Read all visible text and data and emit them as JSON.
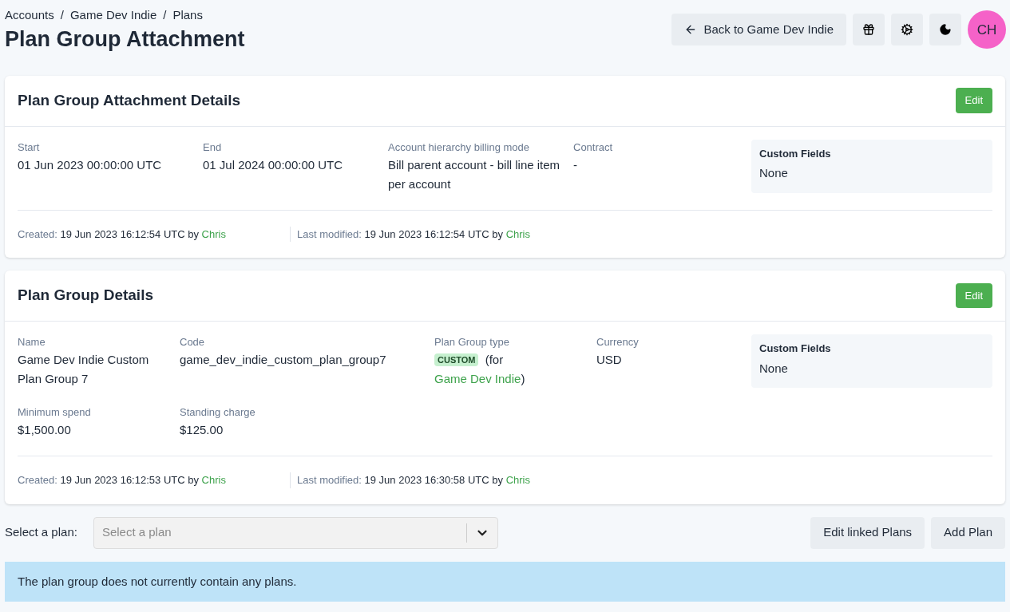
{
  "breadcrumbs": [
    "Accounts",
    "/",
    "Game Dev Indie",
    "/",
    "Plans"
  ],
  "title": "Plan Group Attachment",
  "header_actions": {
    "back_button": "Back to Game Dev Indie",
    "avatar": "CH"
  },
  "cards": [
    {
      "title": "Plan Group Attachment Details",
      "edit_button": "Edit",
      "fields": [
        {
          "label": "Start",
          "value": [
            {
              "kind": "text",
              "text": "01 Jun 2023 00:00:00 UTC"
            }
          ]
        },
        {
          "label": "End",
          "value": [
            {
              "kind": "text",
              "text": "01 Jul 2024 00:00:00 UTC"
            }
          ]
        },
        {
          "label": "Account hierarchy billing mode",
          "value": [
            {
              "kind": "text",
              "text": "Bill parent account - bill line item per account"
            }
          ]
        },
        {
          "label": "Contract",
          "value": [
            {
              "kind": "text",
              "text": "-"
            }
          ]
        }
      ],
      "custom_fields": {
        "label": "Custom Fields",
        "value": "None"
      },
      "footer": [
        [
          {
            "kind": "label",
            "text": "Created:"
          },
          {
            "kind": "text",
            "text": " 19 Jun 2023 16:12:54 UTC by "
          },
          {
            "kind": "link",
            "text": "Chris"
          }
        ],
        [
          {
            "kind": "label",
            "text": "Last modified:"
          },
          {
            "kind": "text",
            "text": " 19 Jun 2023 16:12:54 UTC by "
          },
          {
            "kind": "link",
            "text": "Chris"
          }
        ]
      ]
    },
    {
      "title": "Plan Group Details",
      "edit_button": "Edit",
      "fields": [
        {
          "label": "Name",
          "value": [
            {
              "kind": "text",
              "text": "Game Dev Indie Custom Plan Group 7"
            }
          ]
        },
        {
          "label": "Code",
          "value": [
            {
              "kind": "text",
              "text": "game_dev_indie_custom_plan_group7"
            }
          ]
        },
        {
          "label": "Plan Group type",
          "value": [
            {
              "kind": "badge",
              "text": "CUSTOM"
            },
            {
              "kind": "text",
              "text": " (for "
            },
            {
              "kind": "link",
              "text": "Game Dev Indie"
            },
            {
              "kind": "text",
              "text": ")"
            }
          ]
        },
        {
          "label": "Currency",
          "value": [
            {
              "kind": "text",
              "text": "USD"
            }
          ]
        },
        {
          "label": "Minimum spend",
          "value": [
            {
              "kind": "text",
              "text": "$1,500.00"
            }
          ]
        },
        {
          "label": "Standing charge",
          "value": [
            {
              "kind": "text",
              "text": "$125.00"
            }
          ]
        }
      ],
      "custom_fields": {
        "label": "Custom Fields",
        "value": "None"
      },
      "footer": [
        [
          {
            "kind": "label",
            "text": "Created:"
          },
          {
            "kind": "text",
            "text": " 19 Jun 2023 16:12:53 UTC by "
          },
          {
            "kind": "link",
            "text": "Chris"
          }
        ],
        [
          {
            "kind": "label",
            "text": "Last modified:"
          },
          {
            "kind": "text",
            "text": " 19 Jun 2023 16:30:58 UTC by "
          },
          {
            "kind": "link",
            "text": "Chris"
          }
        ]
      ]
    }
  ],
  "plan_select": {
    "label": "Select a plan:",
    "placeholder": "Select a plan"
  },
  "plan_buttons": [
    "Edit linked Plans",
    "Add Plan"
  ],
  "notice": "The plan group does not currently contain any plans."
}
